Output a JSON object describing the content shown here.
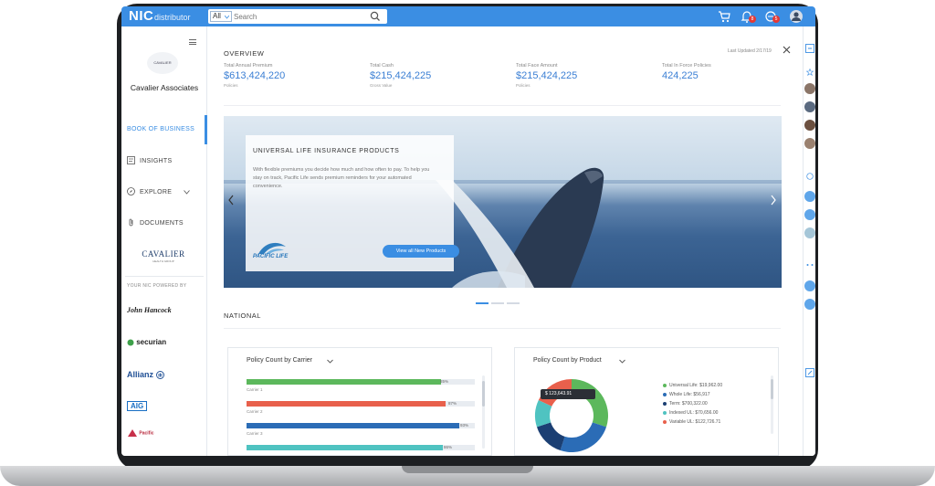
{
  "app": {
    "logo_main": "NIC",
    "logo_sub": "distributor"
  },
  "search": {
    "filter": "All",
    "placeholder": "Search"
  },
  "topbar": {
    "notifications_count": "8",
    "messages_count": "5"
  },
  "sidebar": {
    "agency_logo_text": "CAVALIER",
    "agency_name": "Cavalier Associates",
    "items": [
      {
        "label": "BOOK OF BUSINESS"
      },
      {
        "label": "INSIGHTS"
      },
      {
        "label": "EXPLORE"
      },
      {
        "label": "DOCUMENTS"
      }
    ],
    "brand_logo": "CAVALIER",
    "brand_logo_sub": "HEALTH GROUP",
    "powered_by": "YOUR NIC POWERED BY",
    "carriers": [
      "John Hancock",
      "securian",
      "Allianz",
      "AIG",
      "Pacific"
    ]
  },
  "overview": {
    "title": "OVERVIEW",
    "last_updated": "Last Updated 2/17/19",
    "stats": [
      {
        "label": "Total Annual Premium",
        "value": "$613,424,220",
        "sub": "Policies"
      },
      {
        "label": "Total Cash",
        "value": "$215,424,225",
        "sub": "Gross Value"
      },
      {
        "label": "Total Face Amount",
        "value": "$215,424,225",
        "sub": "Policies"
      },
      {
        "label": "Total In Force Policies",
        "value": "424,225",
        "sub": ""
      }
    ]
  },
  "banner": {
    "title": "UNIVERSAL LIFE INSURANCE PRODUCTS",
    "body": "With flexible premiums you decide how much and how often to pay. To help you stay on track, Pacific Life sends premium reminders for your automated convenience.",
    "logo_text": "PACIFIC LIFE",
    "button_label": "View all New Products",
    "slides": 3,
    "active_slide": 0
  },
  "national": {
    "title": "NATIONAL"
  },
  "carrier_chart": {
    "title": "Policy Count by Carrier",
    "bars": [
      {
        "label": "Carrier 1",
        "value_label": "85%",
        "fraction": 0.85,
        "color": "#5cb85c"
      },
      {
        "label": "Carrier 2",
        "value_label": "87%",
        "fraction": 0.87,
        "color": "#e8604c"
      },
      {
        "label": "Carrier 3",
        "value_label": "93%",
        "fraction": 0.93,
        "color": "#2b6cb6"
      },
      {
        "label": "Carrier 4",
        "value_label": "86%",
        "fraction": 0.86,
        "color": "#4fc3c1"
      }
    ]
  },
  "product_chart": {
    "title": "Policy Count by Product",
    "tooltip": "$ 123,643.91",
    "legend": [
      {
        "label": "Universal Life: $19,962.00",
        "color": "#5cb85c",
        "share": 0.3
      },
      {
        "label": "Whole Life: $56,917",
        "color": "#2b6cb6",
        "share": 0.25
      },
      {
        "label": "Term: $700,322.00",
        "color": "#1b3f73",
        "share": 0.15
      },
      {
        "label": "Indexed UL: $70,656.00",
        "color": "#4fc3c1",
        "share": 0.12
      },
      {
        "label": "Variable UL: $122,726.71",
        "color": "#e8604c",
        "share": 0.18
      }
    ]
  },
  "colors": {
    "accent": "#3b8ee3",
    "value_text": "#3b7fd4"
  }
}
